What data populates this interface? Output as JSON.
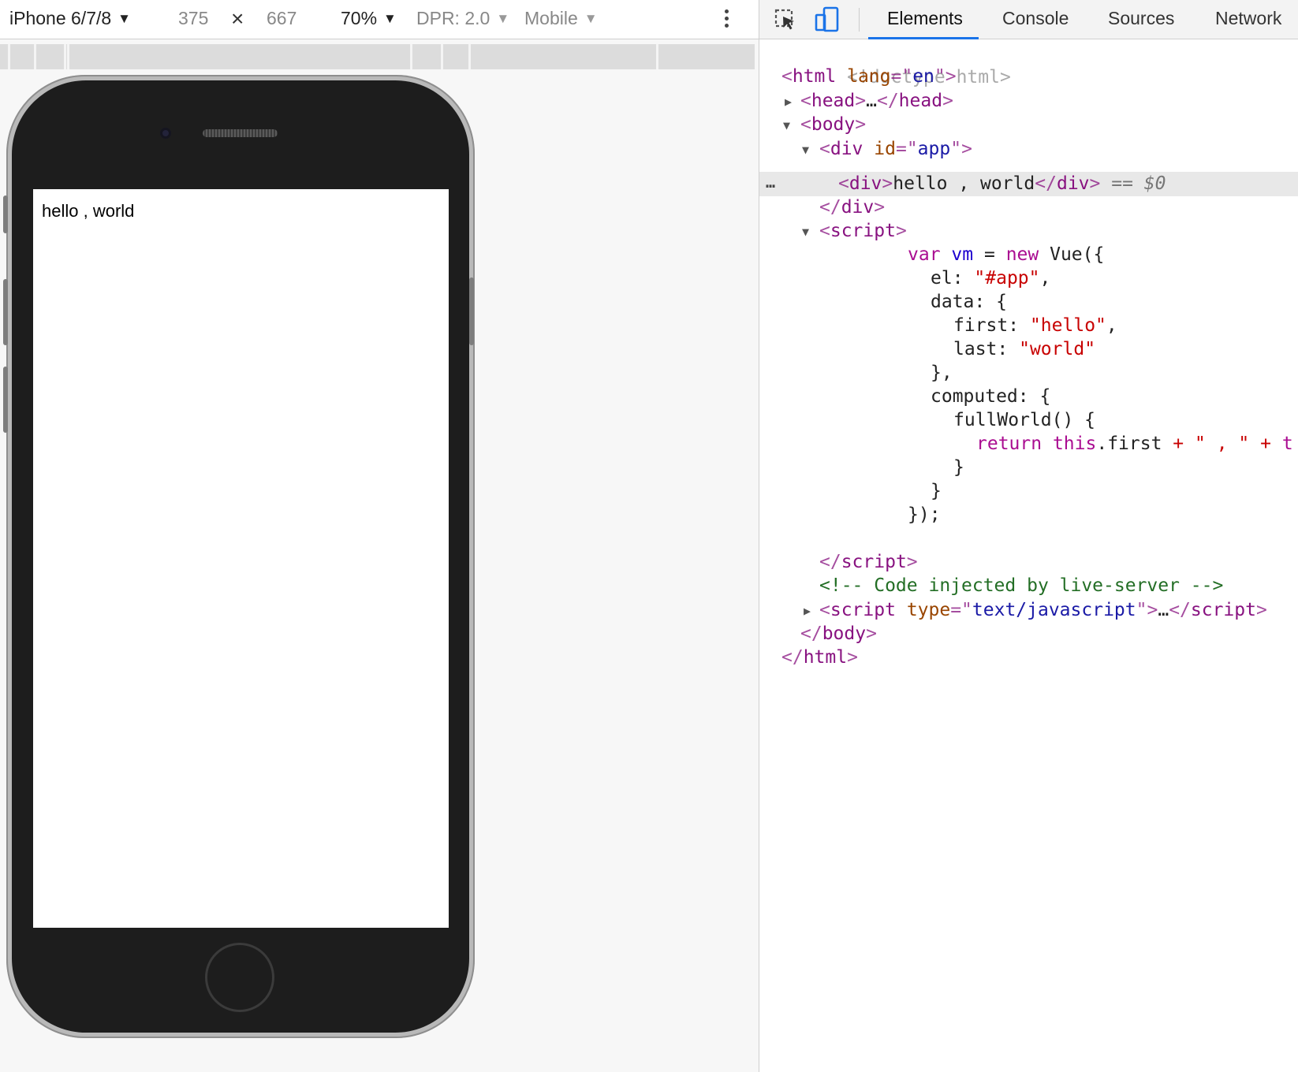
{
  "device_toolbar": {
    "device_name": "iPhone 6/7/8",
    "width": "375",
    "height": "667",
    "dimension_separator": "×",
    "zoom": "70%",
    "dpr": "DPR: 2.0",
    "mode": "Mobile"
  },
  "viewport": {
    "app_text": "hello , world"
  },
  "devtools": {
    "tabs": [
      "Elements",
      "Console",
      "Sources",
      "Network"
    ],
    "active_tab": "Elements",
    "selected_suffix": "== $0",
    "dom_lines": {
      "doctype": "<!doctype html>",
      "html_tag": "html",
      "html_lang_attr": "lang",
      "html_lang_val": "en",
      "head_tag": "head",
      "collapsed": "…",
      "body_tag": "body",
      "div_tag": "div",
      "div_id_attr": "id",
      "div_id_val": "app",
      "selected_text": "hello , world",
      "script_tag": "script",
      "js_var": "var",
      "js_vm": "vm",
      "js_new": "new",
      "js_vue": "Vue({",
      "js_el_key": "el:",
      "js_el_val": "\"#app\"",
      "js_data": "data: {",
      "js_first_key": "first:",
      "js_first_val": "\"hello\"",
      "js_last_key": "last:",
      "js_last_val": "\"world\"",
      "js_close_brace_comma": "},",
      "js_computed": "computed: {",
      "js_fullworld": "fullWorld() {",
      "js_return": "return",
      "js_this": "this",
      "js_first_prop": ".first",
      "js_plus": "+",
      "js_sep_str": "\" , \"",
      "js_trailing": "t",
      "js_close_brace": "}",
      "js_end": "});",
      "comment": "<!-- Code injected by live-server -->",
      "script_type_attr": "type",
      "script_type_val": "text/javascript",
      "html_close_tag": "html"
    }
  },
  "icons": {
    "inspect": "inspect-element-icon",
    "device": "device-toolbar-icon",
    "menu": "kebab-menu-icon"
  },
  "colors": {
    "accent": "#1a73e8",
    "tag": "#881280",
    "attr": "#994500",
    "attr_value": "#1a1aa6",
    "string": "#c80000",
    "keyword": "#aa0d91",
    "comment": "#236e25"
  }
}
